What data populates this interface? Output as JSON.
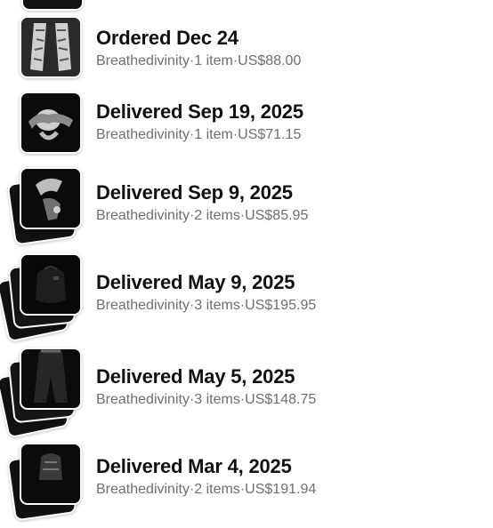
{
  "orders": [
    {
      "title": "Ordered Dec 24",
      "meta": "Breathedivinity·1 item·US$88.00"
    },
    {
      "title": "Delivered Sep 19, 2025",
      "meta": "Breathedivinity·1 item·US$71.15"
    },
    {
      "title": "Delivered Sep 9, 2025",
      "meta": "Breathedivinity·2 items·US$85.95"
    },
    {
      "title": "Delivered May 9, 2025",
      "meta": "Breathedivinity·3 items·US$195.95"
    },
    {
      "title": "Delivered May 5, 2025",
      "meta": "Breathedivinity·3 items·US$148.75"
    },
    {
      "title": "Delivered Mar 4, 2025",
      "meta": "Breathedivinity·2 items·US$191.94"
    }
  ],
  "colors": {
    "title": "#111111",
    "meta": "#6e6e73",
    "thumb_dark": "#0b0b0b"
  }
}
